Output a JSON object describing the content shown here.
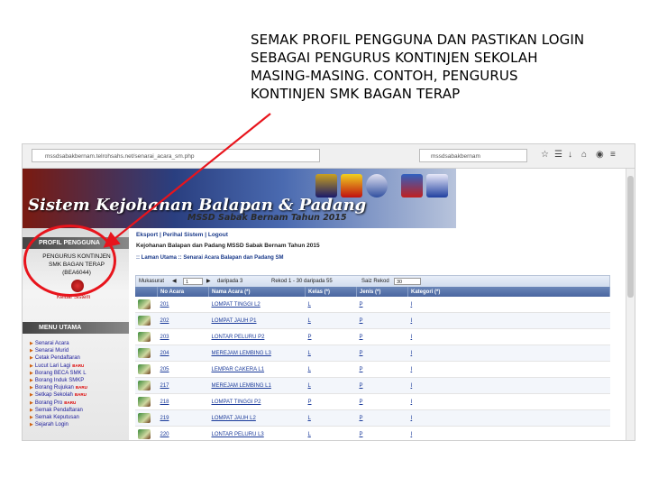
{
  "caption": {
    "lines": [
      "SEMAK PROFIL PENGGUNA DAN PASTIKAN LOGIN",
      "SEBAGAI PENGURUS KONTINJEN SEKOLAH",
      "MASING-MASING. CONTOH, PENGURUS",
      "KONTINJEN SMK BAGAN TERAP"
    ]
  },
  "browser": {
    "url": "mssdsabakbernam.telrohsahs.net/senarai_acara_sm.php",
    "search": "mssdsabakbernam"
  },
  "banner": {
    "title": "Sistem Kejohanan Balapan & Padang",
    "subtitle": "MSSD Sabak Bernam Tahun 2015"
  },
  "sidebar": {
    "profile_header": "PROFIL PENGGUNA",
    "profile_lines": [
      "PENGURUS KONTINJEN",
      "SMK BAGAN TERAP",
      "(BEA6044)"
    ],
    "logout_label": "Keluar Sistem",
    "menu_header": "MENU UTAMA",
    "menu_items": [
      {
        "label": "Senarai Acara",
        "badge": ""
      },
      {
        "label": "Senarai Murid",
        "badge": ""
      },
      {
        "label": "Cetak Pendaftaran",
        "badge": ""
      },
      {
        "label": "Lucut Lari Lagi",
        "badge": "BARU"
      },
      {
        "label": "Borang BECA SMK L",
        "badge": ""
      },
      {
        "label": "Borang Induk SMKP",
        "badge": ""
      },
      {
        "label": "Borang Rujukan",
        "badge": "BARU"
      },
      {
        "label": "Setkap Sekolah",
        "badge": "BARU"
      },
      {
        "label": "Borang Pro",
        "badge": "BARU"
      },
      {
        "label": "Semak Pendaftaran",
        "badge": ""
      },
      {
        "label": "Semak Keputusan",
        "badge": ""
      },
      {
        "label": "Sejarah Login",
        "badge": ""
      }
    ]
  },
  "content": {
    "nav": "Eksport | Perihal Sistem | Logout",
    "title": "Kejohanan Balapan dan Padang MSSD Sabak Bernam Tahun 2015",
    "breadcrumb": ":: Laman Utama :: Senarai Acara Balapan dan Padang SM",
    "pager": {
      "page_label": "Mukasurat",
      "page_value": "1",
      "of_pages": "daripada 3",
      "records": "Rekod 1 - 30 daripada 55",
      "per_page_label": "Saiz Rekod",
      "per_page": "30"
    },
    "table": {
      "headers": [
        "",
        "No Acara",
        "Nama Acara (*)",
        "Kelas (*)",
        "Jenis (*)",
        "Kategori (*)"
      ],
      "rows": [
        {
          "no": "201",
          "name": "LOMPAT TINGGI L2",
          "kelas": "L",
          "jenis": "P",
          "kategori": "I"
        },
        {
          "no": "202",
          "name": "LOMPAT JAUH P1",
          "kelas": "L",
          "jenis": "P",
          "kategori": "I"
        },
        {
          "no": "203",
          "name": "LONTAR PELURU P2",
          "kelas": "P",
          "jenis": "P",
          "kategori": "I"
        },
        {
          "no": "204",
          "name": "MEREJAM LEMBING L3",
          "kelas": "L",
          "jenis": "P",
          "kategori": "I"
        },
        {
          "no": "205",
          "name": "LEMPAR CAKERA L1",
          "kelas": "L",
          "jenis": "P",
          "kategori": "I"
        },
        {
          "no": "217",
          "name": "MEREJAM LEMBING L1",
          "kelas": "L",
          "jenis": "P",
          "kategori": "I"
        },
        {
          "no": "218",
          "name": "LOMPAT TINGGI P2",
          "kelas": "P",
          "jenis": "P",
          "kategori": "I"
        },
        {
          "no": "219",
          "name": "LOMPAT JAUH L2",
          "kelas": "L",
          "jenis": "P",
          "kategori": "I"
        },
        {
          "no": "220",
          "name": "LONTAR PELURU L3",
          "kelas": "L",
          "jenis": "P",
          "kategori": "I"
        }
      ]
    }
  },
  "annotation_color": "#e8141c"
}
